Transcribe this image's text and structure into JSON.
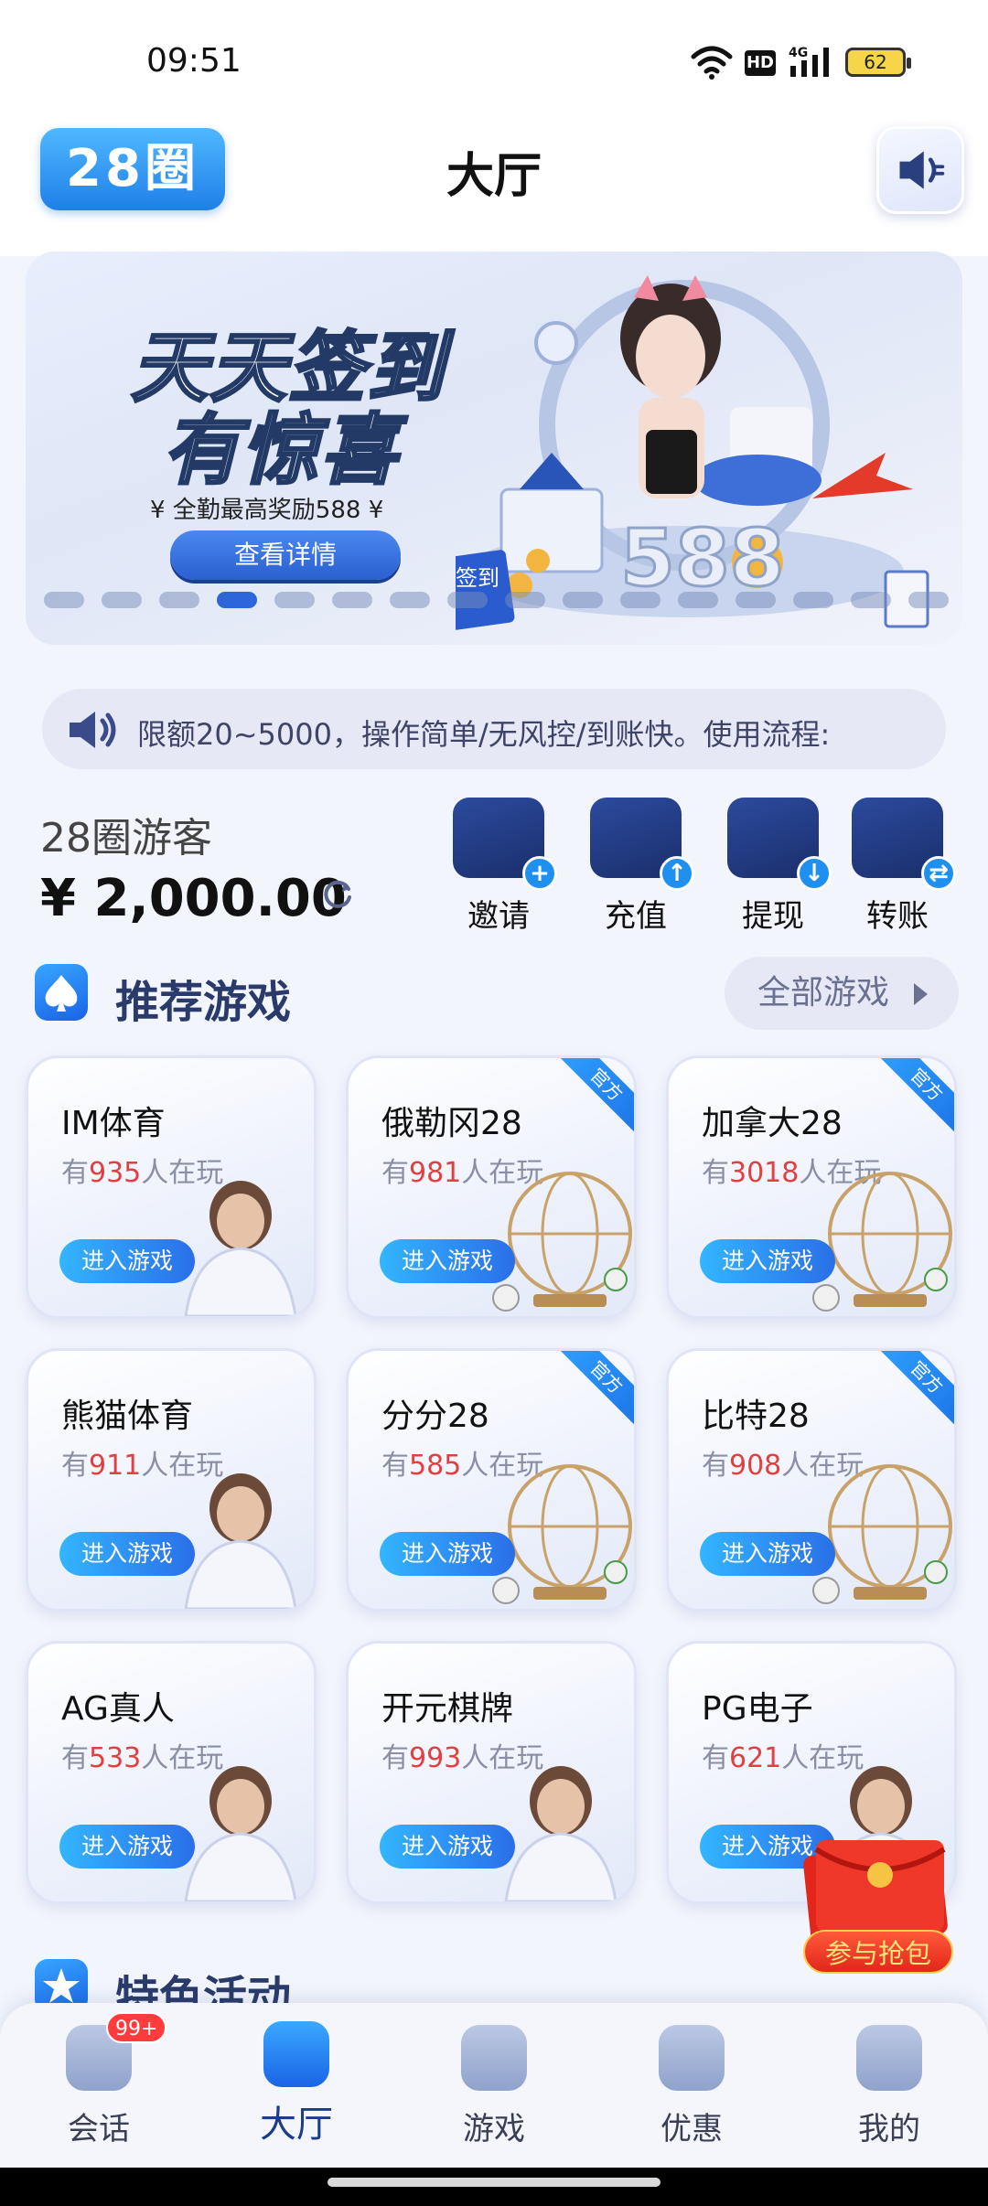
{
  "status": {
    "time": "09:51",
    "hd": "HD",
    "network": "4G",
    "battery": "62"
  },
  "header": {
    "logo": "28圈",
    "title": "大厅"
  },
  "banner": {
    "line1": "天天签到",
    "line2": "有惊喜",
    "subtitle": "¥ 全勤最高奖励588 ¥",
    "button": "查看详情",
    "art_text": "588",
    "sign_text": "签到",
    "total_slides": 16,
    "active_slide": 4
  },
  "notice": {
    "text": "限额20~5000，操作简单/无风控/到账快。使用流程:"
  },
  "account": {
    "name": "28圈游客",
    "balance": "¥ 2,000.00"
  },
  "actions": [
    {
      "label": "邀请",
      "badge": "+"
    },
    {
      "label": "充值",
      "badge": "↑"
    },
    {
      "label": "提现",
      "badge": "↓"
    },
    {
      "label": "转账",
      "badge": "⇄"
    }
  ],
  "section_recommended": {
    "title": "推荐游戏",
    "all_button": "全部游戏"
  },
  "games": [
    {
      "name": "IM体育",
      "prefix": "有",
      "count": "935",
      "suffix": "人在玩",
      "button": "进入游戏",
      "official": ""
    },
    {
      "name": "俄勒冈28",
      "prefix": "有",
      "count": "981",
      "suffix": "人在玩",
      "button": "进入游戏",
      "official": "官方"
    },
    {
      "name": "加拿大28",
      "prefix": "有",
      "count": "3018",
      "suffix": "人在玩",
      "button": "进入游戏",
      "official": "官方"
    },
    {
      "name": "熊猫体育",
      "prefix": "有",
      "count": "911",
      "suffix": "人在玩",
      "button": "进入游戏",
      "official": ""
    },
    {
      "name": "分分28",
      "prefix": "有",
      "count": "585",
      "suffix": "人在玩",
      "button": "进入游戏",
      "official": "官方"
    },
    {
      "name": "比特28",
      "prefix": "有",
      "count": "908",
      "suffix": "人在玩",
      "button": "进入游戏",
      "official": "官方"
    },
    {
      "name": "AG真人",
      "prefix": "有",
      "count": "533",
      "suffix": "人在玩",
      "button": "进入游戏",
      "official": ""
    },
    {
      "name": "开元棋牌",
      "prefix": "有",
      "count": "993",
      "suffix": "人在玩",
      "button": "进入游戏",
      "official": ""
    },
    {
      "name": "PG电子",
      "prefix": "有",
      "count": "621",
      "suffix": "人在玩",
      "button": "进入游戏",
      "official": ""
    }
  ],
  "redpacket": {
    "label": "参与抢包"
  },
  "section_activity": {
    "title": "特色活动"
  },
  "tabs": [
    {
      "label": "会话",
      "badge": "99+",
      "active": false
    },
    {
      "label": "大厅",
      "badge": "",
      "active": true
    },
    {
      "label": "游戏",
      "badge": "",
      "active": false
    },
    {
      "label": "优惠",
      "badge": "",
      "active": false
    },
    {
      "label": "我的",
      "badge": "",
      "active": false
    }
  ],
  "colors": {
    "accent": "#2a6fe8",
    "count": "#e24040",
    "navy": "#1b3c8a"
  }
}
